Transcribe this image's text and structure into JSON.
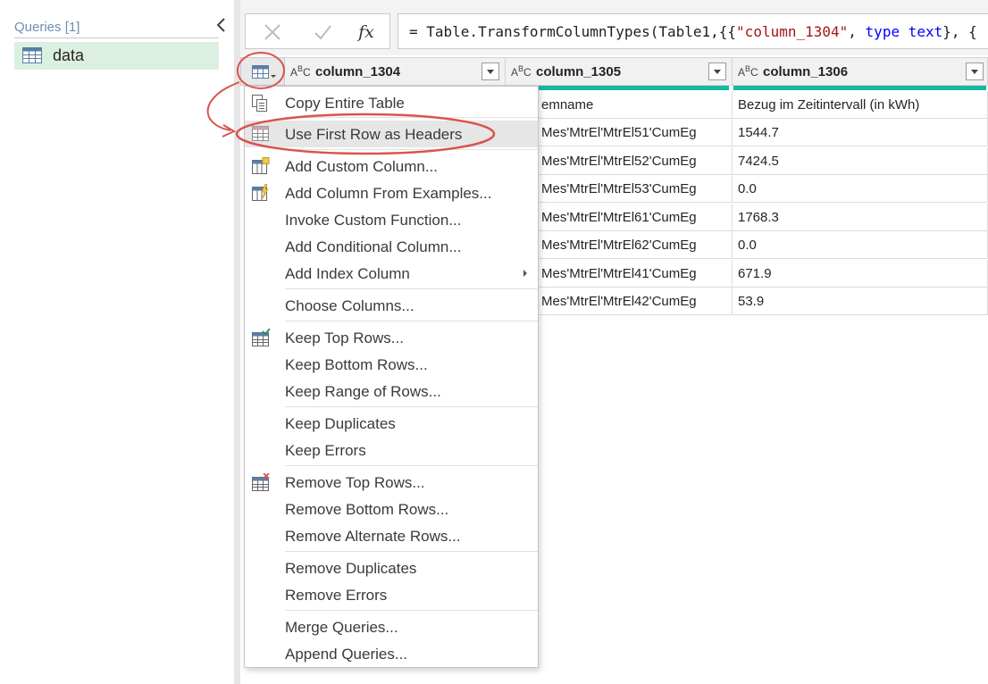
{
  "queries": {
    "header": "Queries [1]",
    "items": [
      {
        "label": "data",
        "icon": "table-icon"
      }
    ]
  },
  "formula_bar": {
    "cancel_icon": "x-icon",
    "confirm_icon": "check-icon",
    "fx_label": "fx",
    "formula_prefix": "= Table.TransformColumnTypes(Table1,{{",
    "formula_string": "\"column_1304\"",
    "formula_mid": ", ",
    "formula_keyword1": "type",
    "formula_space": " ",
    "formula_keyword2": "text",
    "formula_suffix": "}, {"
  },
  "columns": [
    {
      "type_main": "A",
      "type_sup": "B",
      "type_sub": "C",
      "name": "column_1304"
    },
    {
      "type_main": "A",
      "type_sup": "B",
      "type_sub": "C",
      "name": "column_1305"
    },
    {
      "type_main": "A",
      "type_sup": "B",
      "type_sub": "C",
      "name": "column_1306"
    }
  ],
  "rows": [
    {
      "c2": "emname",
      "c3": "Bezug im Zeitintervall (in kWh)"
    },
    {
      "c2": "Mes'MtrEl'MtrEl51'CumEg",
      "c3": "1544.7"
    },
    {
      "c2": "Mes'MtrEl'MtrEl52'CumEg",
      "c3": "7424.5"
    },
    {
      "c2": "Mes'MtrEl'MtrEl53'CumEg",
      "c3": "0.0"
    },
    {
      "c2": "Mes'MtrEl'MtrEl61'CumEg",
      "c3": "1768.3"
    },
    {
      "c2": "Mes'MtrEl'MtrEl62'CumEg",
      "c3": "0.0"
    },
    {
      "c2": "Mes'MtrEl'MtrEl41'CumEg",
      "c3": "671.9"
    },
    {
      "c2": "Mes'MtrEl'MtrEl42'CumEg",
      "c3": "53.9"
    }
  ],
  "menu": {
    "items": [
      {
        "label": "Copy Entire Table"
      },
      {
        "label": "Use First Row as Headers"
      },
      {
        "label": "Add Custom Column..."
      },
      {
        "label": "Add Column From Examples..."
      },
      {
        "label": "Invoke Custom Function..."
      },
      {
        "label": "Add Conditional Column..."
      },
      {
        "label": "Add Index Column"
      },
      {
        "label": "Choose Columns..."
      },
      {
        "label": "Keep Top Rows..."
      },
      {
        "label": "Keep Bottom Rows..."
      },
      {
        "label": "Keep Range of Rows..."
      },
      {
        "label": "Keep Duplicates"
      },
      {
        "label": "Keep Errors"
      },
      {
        "label": "Remove Top Rows..."
      },
      {
        "label": "Remove Bottom Rows..."
      },
      {
        "label": "Remove Alternate Rows..."
      },
      {
        "label": "Remove Duplicates"
      },
      {
        "label": "Remove Errors"
      },
      {
        "label": "Merge Queries..."
      },
      {
        "label": "Append Queries..."
      }
    ]
  },
  "colors": {
    "query_selected": "#dcf0e1",
    "quality_bar": "#17b7a0",
    "annotation": "#d9534f",
    "menu_highlight": "#e6e6e6"
  }
}
